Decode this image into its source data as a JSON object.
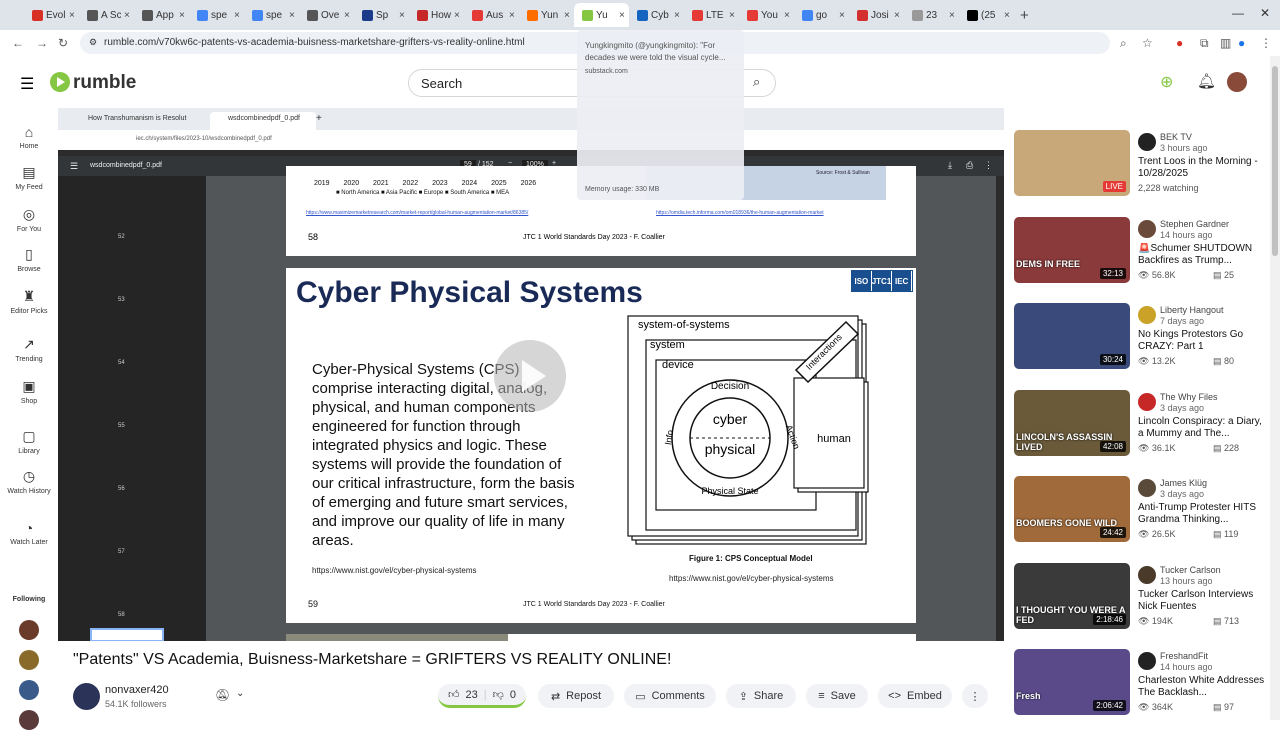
{
  "browser": {
    "tabs": [
      {
        "label": "Evol",
        "color": "#d93025"
      },
      {
        "label": "A Sc",
        "color": "#555555"
      },
      {
        "label": "App",
        "color": "#555555"
      },
      {
        "label": "spe",
        "color": "#4285f4"
      },
      {
        "label": "spe",
        "color": "#4285f4"
      },
      {
        "label": "Ove",
        "color": "#555555"
      },
      {
        "label": "Sp",
        "color": "#1a3a8a"
      },
      {
        "label": "How",
        "color": "#c62828"
      },
      {
        "label": "Aus",
        "color": "#e53935"
      },
      {
        "label": "Yun",
        "color": "#ff6d00"
      },
      {
        "label": "Yu",
        "color": "#85c742"
      },
      {
        "label": "Cyb",
        "color": "#1565c0"
      },
      {
        "label": "LTE",
        "color": "#e53935"
      },
      {
        "label": "You",
        "color": "#e53935"
      },
      {
        "label": "go",
        "color": "#4285f4"
      },
      {
        "label": "Josi",
        "color": "#d32f2f"
      },
      {
        "label": "23",
        "color": "#999999"
      },
      {
        "label": "(25",
        "color": "#000000"
      }
    ],
    "url": "rumble.com/v70kw6c-patents-vs-academia-buisness-marketshare-grifters-vs-reality-online.html"
  },
  "tooltip": {
    "title": "Yungkingmito (@yungkingmito): \"For decades we were told the visual cycle...",
    "domain": "substack.com",
    "memory": "Memory usage: 330 MB"
  },
  "header": {
    "logo": "rumble",
    "search_placeholder": "Search"
  },
  "sidebar": {
    "items": [
      {
        "label": "Home",
        "icon": "⌂"
      },
      {
        "label": "My Feed",
        "icon": "▤"
      },
      {
        "label": "For You",
        "icon": "◎"
      },
      {
        "label": "Browse",
        "icon": "▯"
      },
      {
        "label": "Editor Picks",
        "icon": "♜"
      },
      {
        "label": "Trending",
        "icon": "↗"
      },
      {
        "label": "Shop",
        "icon": "▣"
      },
      {
        "label": "Library",
        "icon": "▢"
      },
      {
        "label": "Watch History",
        "icon": "◷"
      },
      {
        "label": "Watch Later",
        "icon": "◔"
      }
    ],
    "following_label": "Following"
  },
  "player": {
    "inner_tab1": "How Transhumanism is Resolut",
    "inner_tab2": "wsdcombinedpdf_0.pdf",
    "inner_url": "iec.ch/system/files/2023-10/wsdcombinedpdf_0.pdf",
    "pdf_name": "wsdcombinedpdf_0.pdf",
    "pdf_page": "59",
    "pdf_total": "/ 152",
    "pdf_zoom": "100%",
    "thumb_pages": [
      "52",
      "53",
      "54",
      "55",
      "56",
      "57",
      "58"
    ],
    "prev_page": {
      "years": "2019 2020 2021 2022 2023 2024 2025 2026",
      "legend": "■ North America  ■ Asia Pacific  ■ Europe  ■ South America  ■ MEA",
      "link1": "https://www.maximizemarketresearch.com/market-report/global-human-augmentation-market/86385/",
      "link2": "https://omdia.tech.informa.com/om018936/the-human-augmentation-market",
      "source": "Source: Frost & Sullivan",
      "num": "58",
      "footer": "JTC 1 World Standards Day 2023 - F. Coallier"
    },
    "slide": {
      "title": "Cyber Physical Systems",
      "body": "Cyber-Physical Systems (CPS) comprise interacting digital, analog, physical, and human components engineered for function through integrated physics and logic. These systems will provide the foundation of our critical infrastructure, form the basis of emerging and future smart services, and improve our quality of life in many areas.",
      "url_left": "https://www.nist.gov/el/cyber-physical-systems",
      "figure_caption": "Figure 1: CPS Conceptual Model",
      "url_right": "https://www.nist.gov/el/cyber-physical-systems",
      "num": "59",
      "footer": "JTC 1 World Standards Day 2023 - F. Coallier",
      "logo_iso": "ISO",
      "logo_jtc": "JTC1",
      "logo_iec": "IEC",
      "diagram": {
        "sos": "system-of-systems",
        "system": "system",
        "device": "device",
        "decision": "Decision",
        "action": "Action",
        "info": "Info",
        "physical_state": "Physical State",
        "cyber": "cyber",
        "physical": "physical",
        "human": "human",
        "interactions": "Interactions"
      }
    }
  },
  "video": {
    "title": "\"Patents\" VS Academia, Buisness-Marketshare = GRIFTERS VS REALITY ONLINE!",
    "channel": "nonvaxer420",
    "followers": "54.1K followers",
    "likes": "23",
    "dislikes": "0",
    "actions": {
      "repost": "Repost",
      "comments": "Comments",
      "share": "Share",
      "save": "Save",
      "embed": "Embed"
    }
  },
  "recommendations": [
    {
      "channel": "BEK TV",
      "ago": "3 hours ago",
      "title": "Trent Loos in the Morning - 10/28/2025",
      "stat": "2,228 watching",
      "stat2": "",
      "live": "LIVE",
      "dur": "",
      "caption": "",
      "bg": "#c8a878",
      "av": "#222222"
    },
    {
      "channel": "Stephen Gardner",
      "ago": "14 hours ago",
      "title": "🚨Schumer SHUTDOWN Backfires as Trump...",
      "stat": "👁 56.8K",
      "stat2": "▤ 25",
      "live": "",
      "dur": "32:13",
      "caption": "DEMS IN FREE",
      "bg": "#8a3a3a",
      "av": "#6a4a3a"
    },
    {
      "channel": "Liberty Hangout",
      "ago": "7 days ago",
      "title": "No Kings Protestors Go CRAZY: Part 1",
      "stat": "👁 13.2K",
      "stat2": "▤ 80",
      "live": "",
      "dur": "30:24",
      "caption": "",
      "bg": "#3a4a7a",
      "av": "#c9a227"
    },
    {
      "channel": "The Why Files",
      "ago": "3 days ago",
      "title": "Lincoln Conspiracy: a Diary, a Mummy and The...",
      "stat": "👁 36.1K",
      "stat2": "▤ 228",
      "live": "",
      "dur": "42:08",
      "caption": "LINCOLN'S ASSASSIN LIVED",
      "bg": "#6a5a3a",
      "av": "#c62828"
    },
    {
      "channel": "James Klüg",
      "ago": "3 days ago",
      "title": "Anti-Trump Protester HITS Grandma Thinking...",
      "stat": "👁 26.5K",
      "stat2": "▤ 119",
      "live": "",
      "dur": "24:42",
      "caption": "BOOMERS GONE WILD",
      "bg": "#a06a3a",
      "av": "#5a4a3a"
    },
    {
      "channel": "Tucker Carlson",
      "ago": "13 hours ago",
      "title": "Tucker Carlson Interviews Nick Fuentes",
      "stat": "👁 194K",
      "stat2": "▤ 713",
      "live": "",
      "dur": "2:18:46",
      "caption": "I THOUGHT YOU WERE A FED",
      "bg": "#3a3a3a",
      "av": "#4a3a2a"
    },
    {
      "channel": "FreshandFit",
      "ago": "14 hours ago",
      "title": "Charleston White Addresses The Backlash...",
      "stat": "👁 364K",
      "stat2": "▤ 97",
      "live": "",
      "dur": "2:06:42",
      "caption": "Fresh",
      "bg": "#5a4a8a",
      "av": "#222222"
    }
  ]
}
